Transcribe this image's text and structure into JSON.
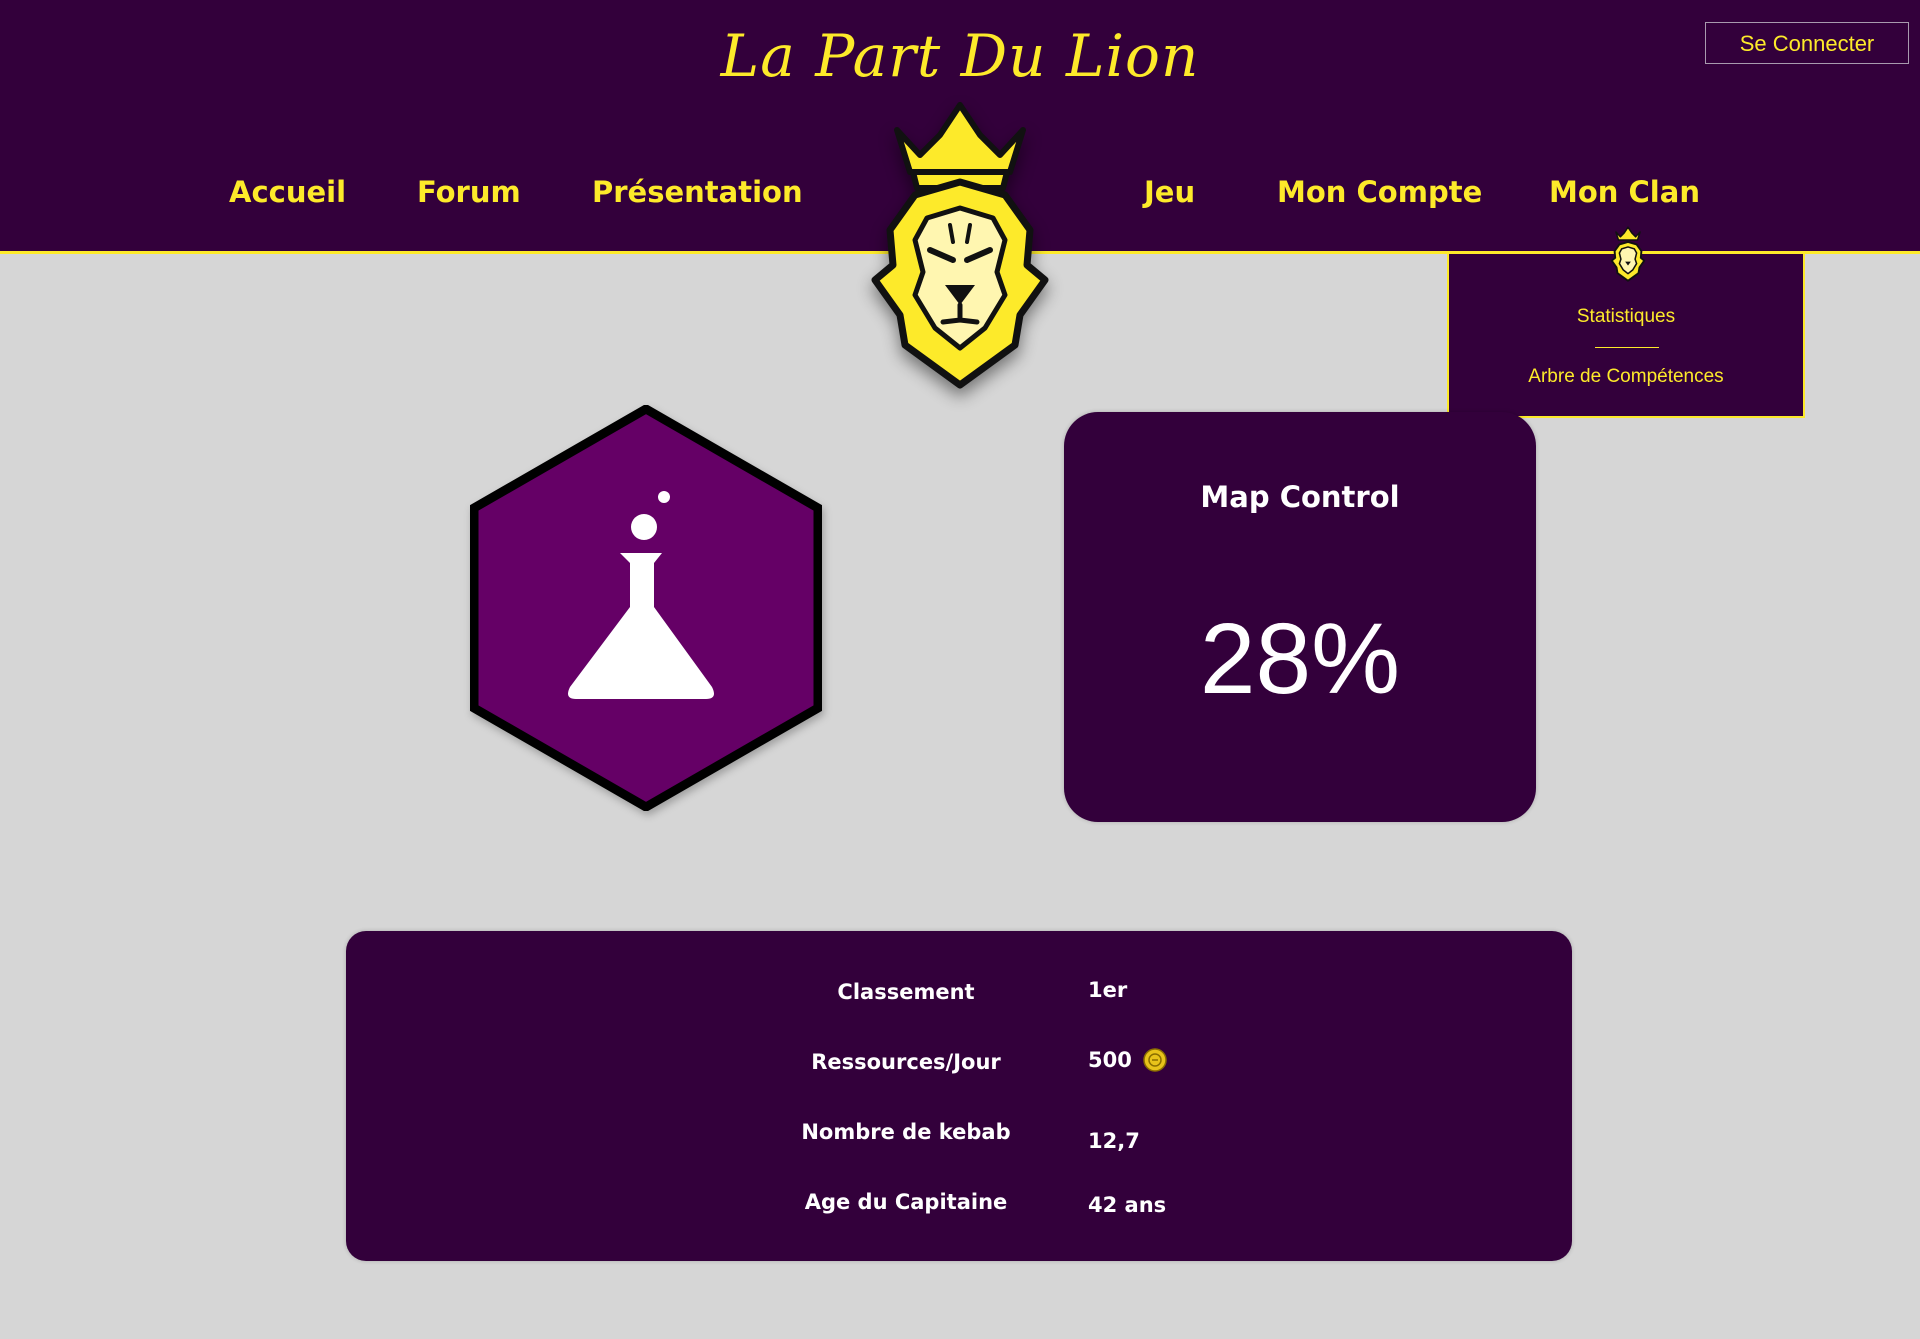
{
  "header": {
    "brand": "La Part Du Lion",
    "login_label": "Se Connecter",
    "logo_icon": "crowned-lion-icon"
  },
  "nav": {
    "items": [
      {
        "label": "Accueil"
      },
      {
        "label": "Forum"
      },
      {
        "label": "Présentation"
      },
      {
        "label": "Jeu"
      },
      {
        "label": "Mon Compte"
      },
      {
        "label": "Mon Clan"
      }
    ]
  },
  "dropdown": {
    "icon": "crowned-lion-icon",
    "items": [
      {
        "label": "Statistiques"
      },
      {
        "label": "Arbre de Compétences"
      }
    ]
  },
  "clan": {
    "emblem_icon": "flask-icon"
  },
  "stat": {
    "title": "Map Control",
    "value": "28%"
  },
  "info": {
    "rows": [
      {
        "label": "Classement",
        "value": "1er"
      },
      {
        "label": "Ressources/Jour",
        "value": "500",
        "icon": "coin-icon"
      },
      {
        "label": "Nombre de kebab",
        "value": "12,7"
      },
      {
        "label": "Age du Capitaine",
        "value": "42 ans"
      }
    ]
  },
  "colors": {
    "header_bg": "#33003b",
    "accent": "#fdea2a",
    "page_bg": "#d6d6d6",
    "hex_fill": "#650066"
  }
}
